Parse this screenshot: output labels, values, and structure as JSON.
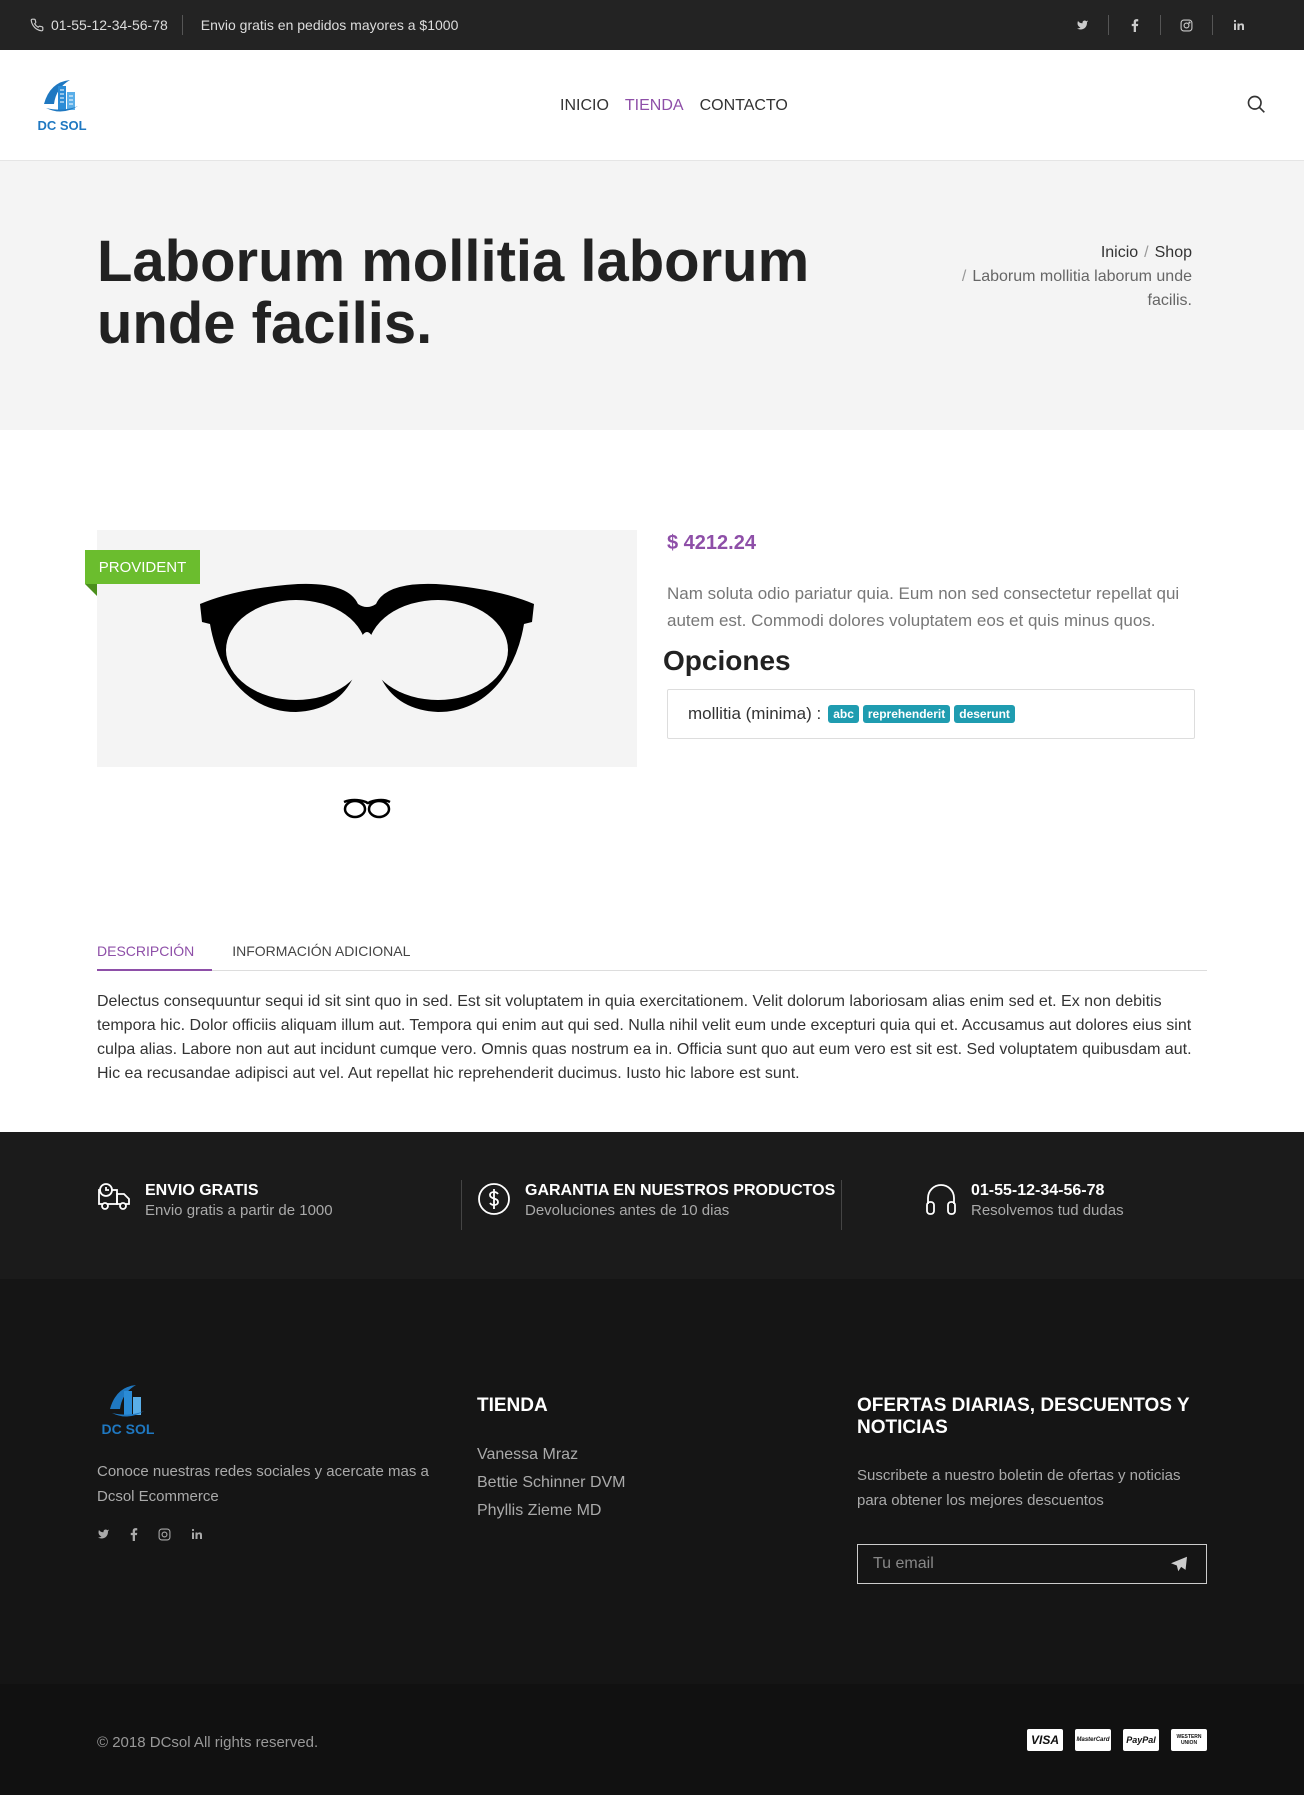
{
  "topbar": {
    "phone": "01-55-12-34-56-78",
    "shipping": "Envio gratis en pedidos mayores a $1000",
    "social_icons": [
      "twitter-icon",
      "facebook-icon",
      "instagram-icon",
      "linkedin-icon"
    ]
  },
  "header": {
    "logo_text": "DC SOL",
    "nav": [
      {
        "label": "INICIO"
      },
      {
        "label": "TIENDA"
      },
      {
        "label": "CONTACTO"
      }
    ],
    "active_nav": "TIENDA"
  },
  "hero": {
    "title": "Laborum mollitia laborum unde facilis.",
    "breadcrumb": {
      "home": "Inicio",
      "shop": "Shop",
      "current": "Laborum mollitia laborum unde facilis."
    }
  },
  "product": {
    "brand_badge": "PROVIDENT",
    "price": "$ 4212.24",
    "description": "Nam soluta odio pariatur quia. Eum non sed consectetur repellat qui autem est. Commodi dolores voluptatem eos et quis minus quos.",
    "options_title": "Opciones",
    "option_label": "mollitia (minima) :",
    "option_values": [
      "abc",
      "reprehenderit",
      "deserunt"
    ]
  },
  "tabs": {
    "items": [
      "DESCRIPCIÓN",
      "INFORMACIÓN ADICIONAL"
    ],
    "active": "DESCRIPCIÓN",
    "content": "Delectus consequuntur sequi id sit sint quo in sed. Est sit voluptatem in quia exercitationem. Velit dolorum laboriosam alias enim sed et. Ex non debitis tempora hic. Dolor officiis aliquam illum aut. Tempora qui enim aut qui sed. Nulla nihil velit eum unde excepturi quia qui et. Accusamus aut dolores eius sint culpa alias. Labore non aut aut incidunt cumque vero. Omnis quas nostrum ea in. Officia sunt quo aut eum vero est sit est. Sed voluptatem quibusdam aut. Hic ea recusandae adipisci aut vel. Aut repellat hic reprehenderit ducimus. Iusto hic labore est sunt."
  },
  "features": [
    {
      "title": "ENVIO GRATIS",
      "subtitle": "Envio gratis a partir de 1000",
      "icon": "truck-icon"
    },
    {
      "title": "GARANTIA EN NUESTROS PRODUCTOS",
      "subtitle": "Devoluciones antes de 10 dias",
      "icon": "dollar-icon"
    },
    {
      "title": "01-55-12-34-56-78",
      "subtitle": "Resolvemos tud dudas",
      "icon": "headphones-icon"
    }
  ],
  "footer": {
    "logo_text": "DC SOL",
    "about": "Conoce nuestras redes sociales y acercate mas a Dcsol Ecommerce",
    "shop_title": "TIENDA",
    "shop_links": [
      "Vanessa Mraz",
      "Bettie Schinner DVM",
      "Phyllis Zieme MD"
    ],
    "news_title": "OFERTAS DIARIAS, DESCUENTOS Y NOTICIAS",
    "news_text": "Suscribete a nuestro boletin de ofertas y noticias para obtener los mejores descuentos",
    "email_placeholder": "Tu email",
    "copyright": "© 2018 DCsol All rights reserved.",
    "payments": [
      "VISA",
      "MasterCard",
      "PayPal",
      "WESTERN UNION"
    ]
  },
  "colors": {
    "accent": "#8e4fa8",
    "badge": "#6bbd2e",
    "tag": "#1f9cb0",
    "dark": "#1b1b1b"
  }
}
